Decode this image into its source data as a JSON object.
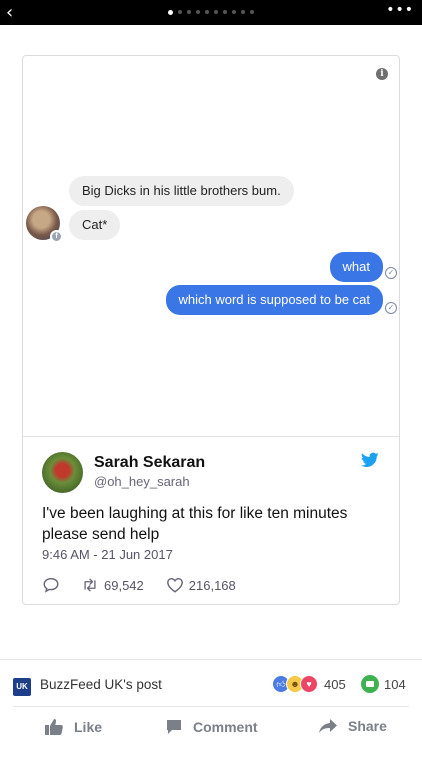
{
  "topbar": {
    "back_icon": "chevron-left-icon",
    "more_label": "•••",
    "pager_total": 10,
    "pager_active": 0
  },
  "chat": {
    "incoming": [
      "Big Dicks in his little brothers bum.",
      "Cat*"
    ],
    "outgoing": [
      "what",
      "which word is supposed to be cat"
    ],
    "outgoing_color": "#3b76e6",
    "incoming_color": "#eeeeef"
  },
  "tweet": {
    "name": "Sarah Sekaran",
    "handle": "@oh_hey_sarah",
    "text": "I've been laughing at this for like ten minutes please send help",
    "timestamp": "9:46 AM - 21 Jun 2017",
    "retweets": "69,542",
    "likes": "216,168",
    "brand_color": "#1da1f2"
  },
  "post": {
    "source_logo": "UK",
    "source_label": "BuzzFeed UK's post",
    "reaction_count": "405",
    "comment_count": "104",
    "actions": {
      "like": "Like",
      "comment": "Comment",
      "share": "Share"
    }
  }
}
